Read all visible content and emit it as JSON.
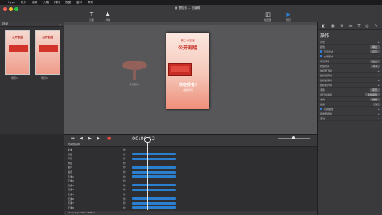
{
  "menubar": {
    "apple": "",
    "app": "Hype",
    "items": [
      "文件",
      "编辑",
      "元素",
      "排列",
      "视图",
      "窗口",
      "帮助"
    ]
  },
  "toolbar": {
    "title": "冒险派",
    "title_suffix": "— 已编辑",
    "buttons": [
      {
        "icon": "T",
        "label": "元素"
      },
      {
        "icon": "♟",
        "label": "人物"
      },
      {
        "icon": "◫",
        "label": "检查器"
      },
      {
        "icon": "▶",
        "label": "预览"
      }
    ],
    "accent": "#2b7fd0"
  },
  "scenes": {
    "header_left": "场景",
    "header_right": "布局",
    "thumb_title": "公开剧组",
    "thumb_labels": [
      "场景1",
      "场景2"
    ]
  },
  "stage": {
    "sub": "第二十五届",
    "main": "公开剧组",
    "cta": "现在报名!",
    "cta2": "点击参与",
    "ghost_label": "有乐互动!"
  },
  "inspector": {
    "tabs": [
      "◧",
      "▣",
      "⚙",
      "≣",
      "T",
      "◎",
      "✎"
    ],
    "title": "操作",
    "rows": [
      {
        "label": "背景",
        "value": ""
      },
      {
        "label": "颜色",
        "value": "填充"
      },
      {
        "label": "显示状态",
        "value": "可见",
        "check": true
      },
      {
        "label": "在场景中",
        "value": "",
        "check": true
      },
      {
        "label": "场景转场",
        "value": "淡入"
      },
      {
        "label": "持续时间",
        "value": "0.6"
      },
      {
        "label": "鼠标按下时",
        "value": ""
      },
      {
        "label": "鼠标松开时",
        "value": ""
      },
      {
        "label": "鼠标悬停时",
        "value": ""
      },
      {
        "label": "鼠标离开时",
        "value": ""
      },
      {
        "label": "手势",
        "value": "手型"
      },
      {
        "label": "运行时间线",
        "value": "主时间线"
      },
      {
        "label": "方向",
        "value": "向前"
      },
      {
        "label": "继续",
        "value": "0"
      },
      {
        "label": "使用播放",
        "value": "",
        "check": true
      },
      {
        "label": "键盘按键时",
        "value": ""
      },
      {
        "label": "滚动",
        "value": ""
      }
    ]
  },
  "playbar": {
    "timecode": "00:00.12"
  },
  "timeline": {
    "head": "时间线名称",
    "layers": [
      "文本",
      "标题",
      "背景",
      "按钮",
      "图片",
      "组合",
      "元素1",
      "元素2",
      "元素3",
      "元素4",
      "元素5",
      "元素6",
      "元素7",
      "元素8"
    ],
    "bottom": "StageIngredFixedEffect",
    "scene_title": "主时间线"
  }
}
